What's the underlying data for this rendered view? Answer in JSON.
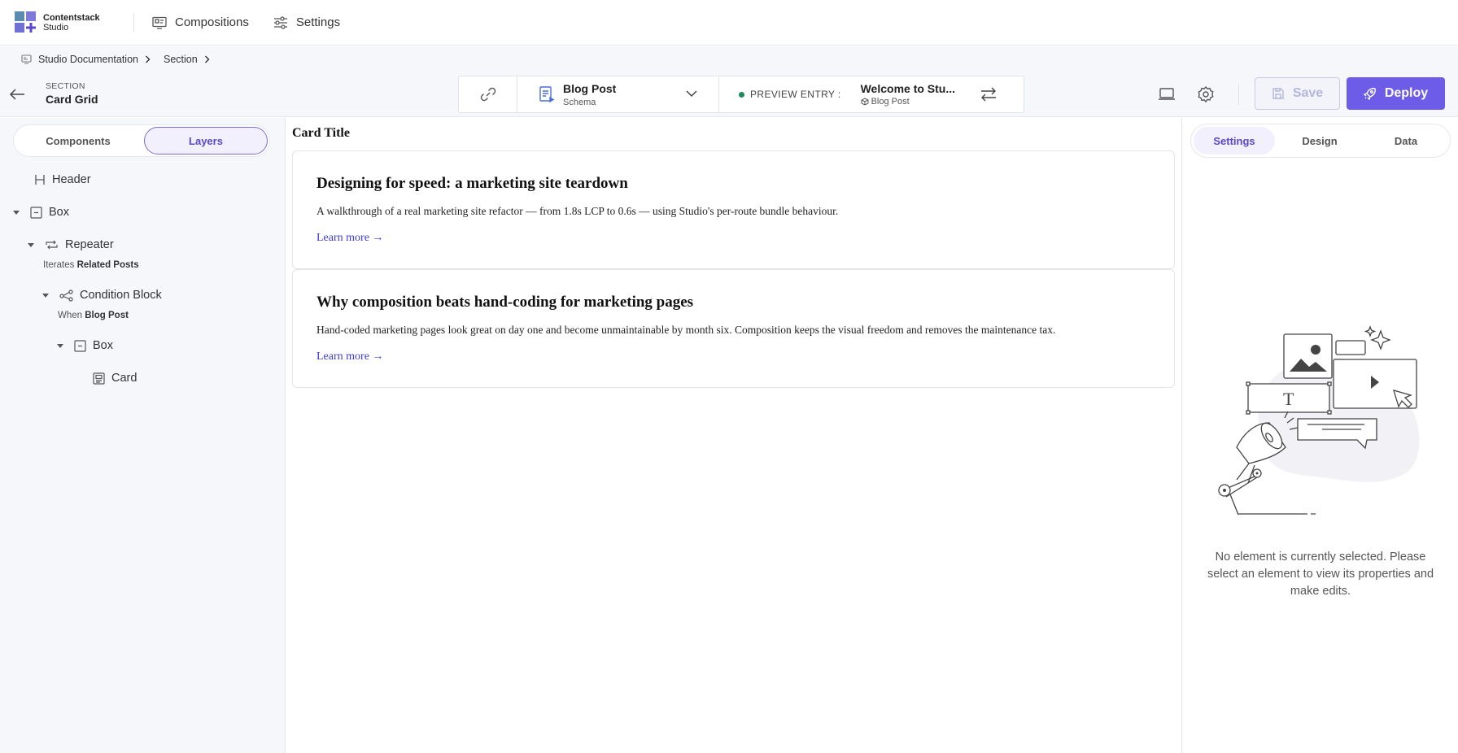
{
  "app": {
    "brand_line1": "Contentstack",
    "brand_line2": "Studio",
    "colors": {
      "accent": "#6c5ce7",
      "live_dot": "#1f8a5c"
    }
  },
  "nav": {
    "items": [
      {
        "label": "Compositions",
        "icon": "compositions-icon"
      },
      {
        "label": "Settings",
        "icon": "sliders-icon"
      }
    ]
  },
  "breadcrumb": {
    "items": [
      "Studio Documentation",
      "Section"
    ]
  },
  "toolbar": {
    "section_label": "SECTION",
    "section_title": "Card Grid",
    "schema_name": "Blog Post",
    "schema_sub": "Schema",
    "preview_label": "PREVIEW ENTRY :",
    "preview_entry": "Welcome to Stu...",
    "preview_type": "Blog Post",
    "save_label": "Save",
    "deploy_label": "Deploy"
  },
  "left_panel": {
    "tabs": [
      "Components",
      "Layers"
    ],
    "active_tab": "Layers",
    "tree": {
      "header": "Header",
      "box1": "Box",
      "repeater": "Repeater",
      "repeater_sub_prefix": "Iterates",
      "repeater_sub_value": "Related Posts",
      "condition": "Condition Block",
      "condition_sub_prefix": "When",
      "condition_sub_value": "Blog Post",
      "box2": "Box",
      "card": "Card"
    }
  },
  "canvas": {
    "card_title": "Card Title",
    "cards": [
      {
        "title": "Designing for speed: a marketing site teardown",
        "body": "A walkthrough of a real marketing site refactor — from 1.8s LCP to 0.6s — using Studio's per-route bundle behaviour.",
        "link": "Learn more →"
      },
      {
        "title": "Why composition beats hand-coding for marketing pages",
        "body": "Hand-coded marketing pages look great on day one and become unmaintainable by month six. Composition keeps the visual freedom and removes the maintenance tax.",
        "link": "Learn more →"
      }
    ]
  },
  "right_panel": {
    "tabs": [
      "Settings",
      "Design",
      "Data"
    ],
    "active_tab": "Settings",
    "empty_message": "No element is currently selected. Please select an element to view its properties and make edits."
  }
}
